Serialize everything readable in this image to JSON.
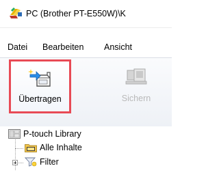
{
  "window": {
    "title": "PC (Brother PT-E550W)\\K",
    "app_icon": "ptouch-editor-icon"
  },
  "menu": {
    "items": [
      "Datei",
      "Bearbeiten",
      "Ansicht"
    ]
  },
  "toolbar": {
    "buttons": [
      {
        "label": "Übertragen",
        "icon": "transfer-icon",
        "state": "enabled",
        "highlighted": true,
        "highlight_color": "#e84a55"
      },
      {
        "label": "Sichern",
        "icon": "backup-device-icon",
        "state": "disabled"
      }
    ]
  },
  "tree": {
    "root": {
      "label": "P-touch Library",
      "icon": "library-icon"
    },
    "children": [
      {
        "label": "Alle Inhalte",
        "icon": "folder-icon"
      },
      {
        "label": "Filter",
        "icon": "filter-icon",
        "expandable": true
      }
    ]
  },
  "colors": {
    "highlight": "#e84a55",
    "disabled_text": "#b9b9b9"
  }
}
